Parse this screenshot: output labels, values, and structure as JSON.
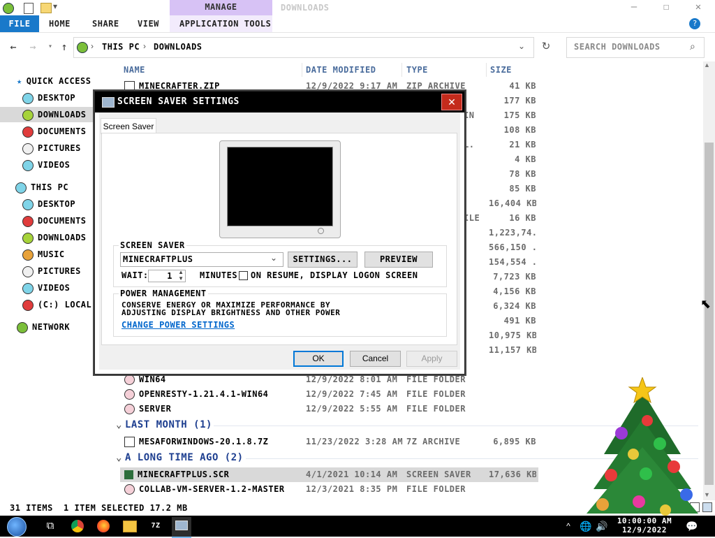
{
  "window": {
    "title": "Downloads",
    "context_tab": "Manage",
    "controls": {
      "minimize": "—",
      "maximize": "☐",
      "close": "✕"
    }
  },
  "ribbon": {
    "tabs": [
      "File",
      "Home",
      "Share",
      "View",
      "Application Tools"
    ],
    "help": "?"
  },
  "address": {
    "crumbs": [
      "This PC",
      "Downloads"
    ],
    "search_placeholder": "Search Downloads"
  },
  "nav": {
    "quick_access": "Quick access",
    "qa_items": [
      "Desktop",
      "Downloads",
      "Documents",
      "Pictures",
      "Videos"
    ],
    "this_pc": "This PC",
    "pc_items": [
      "Desktop",
      "Documents",
      "Downloads",
      "Music",
      "Pictures",
      "Videos",
      "(C:) Local Di"
    ],
    "network": "Network"
  },
  "columns": {
    "name": "Name",
    "date": "Date modified",
    "type": "Type",
    "size": "Size"
  },
  "files_top": [
    {
      "name": "minecrafter.zip",
      "date": "12/9/2022 9:17 AM",
      "type": "ZIP Archive",
      "size": "41 KB"
    }
  ],
  "partial_types": [
    {
      "text": "IN",
      "row": 2
    },
    {
      "text": "L.",
      "row": 4
    },
    {
      "text": "ILE",
      "row": 9
    }
  ],
  "sizes_visible": [
    "177 KB",
    "175 KB",
    "108 KB",
    "21 KB",
    "4 KB",
    "78 KB",
    "85 KB",
    "16,404 KB",
    "16 KB",
    "1,223,74...",
    "566,150 ...",
    "154,554 ...",
    "7,723 KB",
    "4,156 KB",
    "6,324 KB",
    "491 KB",
    "10,975 KB",
    "11,157 KB"
  ],
  "files_folders": [
    {
      "name": "win64",
      "date": "12/9/2022 8:01 AM",
      "type": "File folder",
      "size": ""
    },
    {
      "name": "openresty-1.21.4.1-win64",
      "date": "12/9/2022 7:45 AM",
      "type": "File folder",
      "size": ""
    },
    {
      "name": "server",
      "date": "12/9/2022 5:55 AM",
      "type": "File folder",
      "size": ""
    }
  ],
  "group_last_month": "Last month (1)",
  "files_last_month": [
    {
      "name": "mesaforwindows-20.1.8.7z",
      "date": "11/23/2022 3:28 AM",
      "type": "7Z Archive",
      "size": "6,895 KB"
    }
  ],
  "group_long_ago": "A long time ago (2)",
  "files_long_ago": [
    {
      "name": "MinecraftPlus.scr",
      "date": "4/1/2021 10:14 AM",
      "type": "Screen saver",
      "size": "17,636 KB"
    },
    {
      "name": "collab-vm-server-1.2-master",
      "date": "12/3/2021 8:35 PM",
      "type": "File folder",
      "size": ""
    }
  ],
  "status": {
    "items": "31 items",
    "selected": "1 item selected  17.2 MB"
  },
  "dialog": {
    "title": "Screen Saver Settings",
    "close": "✕",
    "tab": "Screen Saver",
    "group_screensaver": "Screen saver",
    "selected_saver": "MinecraftPlus",
    "settings_btn": "Settings...",
    "preview_btn": "Preview",
    "wait_label": "Wait:",
    "wait_value": "1",
    "minutes_label": "minutes",
    "resume_label": "On resume, display logon screen",
    "group_power": "Power management",
    "power_text": "Conserve energy or maximize performance by adjusting display brightness and other power",
    "power_link": "Change power settings",
    "ok": "OK",
    "cancel": "Cancel",
    "apply": "Apply"
  },
  "taskbar": {
    "time": "10:00:00 AM",
    "date": "12/9/2022",
    "apps": [
      "start-icon",
      "task-view-icon",
      "chrome-icon",
      "firefox-icon",
      "file-explorer-icon",
      "7zip-icon",
      "screensaver-icon"
    ]
  },
  "colors": {
    "file_tab": "#1979ca",
    "manage_tab": "#d7c2f5",
    "group_header": "#1e3f90",
    "close_red": "#c42b1c"
  }
}
